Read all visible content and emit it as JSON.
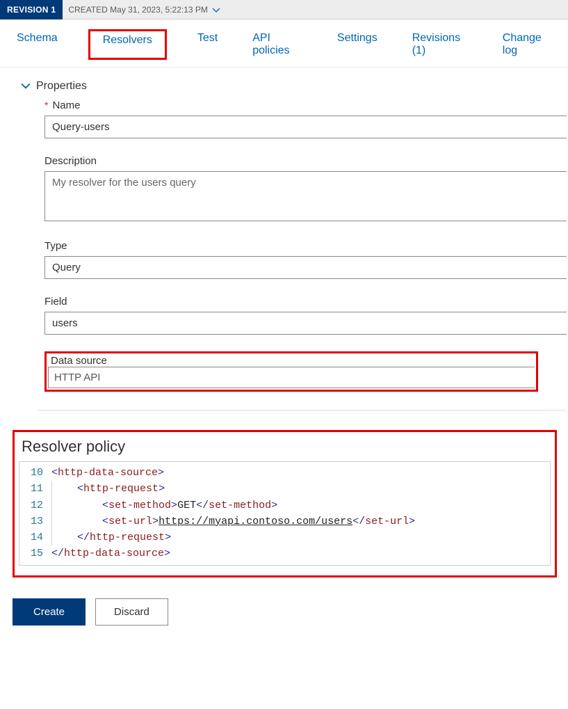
{
  "header": {
    "revision_badge": "REVISION 1",
    "created_label": "CREATED May 31, 2023, 5:22:13 PM"
  },
  "tabs": {
    "schema": "Schema",
    "resolvers": "Resolvers",
    "test": "Test",
    "api_policies": "API policies",
    "settings": "Settings",
    "revisions": "Revisions (1)",
    "change_log": "Change log"
  },
  "section": {
    "properties_title": "Properties"
  },
  "form": {
    "name_label": "Name",
    "name_value": "Query-users",
    "description_label": "Description",
    "description_value": "My resolver for the users query",
    "type_label": "Type",
    "type_value": "Query",
    "field_label": "Field",
    "field_value": "users",
    "ds_label": "Data source",
    "ds_value": "HTTP API"
  },
  "resolver": {
    "title": "Resolver policy",
    "lines": {
      "l10_num": "10",
      "l11_num": "11",
      "l12_num": "12",
      "l13_num": "13",
      "l14_num": "14",
      "l15_num": "15"
    },
    "tokens": {
      "http_data_source": "http-data-source",
      "http_request": "http-request",
      "set_method": "set-method",
      "set_url": "set-url",
      "get": "GET",
      "url": "https://myapi.contoso.com/users"
    }
  },
  "buttons": {
    "create": "Create",
    "discard": "Discard"
  }
}
